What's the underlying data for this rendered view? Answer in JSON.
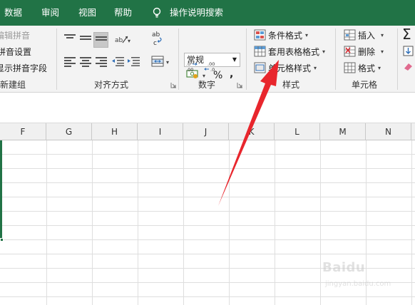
{
  "menu": {
    "tabs": [
      "数据",
      "审阅",
      "视图",
      "帮助"
    ],
    "search": "操作说明搜索"
  },
  "ribbon": {
    "phonetic": {
      "edit": "编辑拼音",
      "settings": "拼音设置",
      "show_field": "显示拼音字段",
      "group_label": "新建组"
    },
    "alignment": {
      "group_label": "对齐方式",
      "wrap_text_glyph": "ab c"
    },
    "number": {
      "format_value": "常规",
      "group_label": "数字",
      "percent_symbol": "%",
      "comma_symbol": ",",
      "inc_decimal": ".00 →.0",
      "dec_decimal": ".00 ←.0"
    },
    "styles": {
      "conditional": "条件格式",
      "table": "套用表格格式",
      "cell_styles": "单元格样式",
      "group_label": "样式"
    },
    "cells": {
      "insert": "插入",
      "delete": "删除",
      "format": "格式",
      "group_label": "单元格"
    },
    "editing": {
      "sum_glyph": "Σ"
    }
  },
  "sheet": {
    "columns": [
      "F",
      "G",
      "H",
      "I",
      "J",
      "K",
      "L",
      "M",
      "N"
    ]
  },
  "watermark": {
    "brand": "Baidu",
    "sub": "jingyan.baidu.com"
  },
  "colors": {
    "accent": "#217346",
    "arrow": "#e8262d"
  }
}
